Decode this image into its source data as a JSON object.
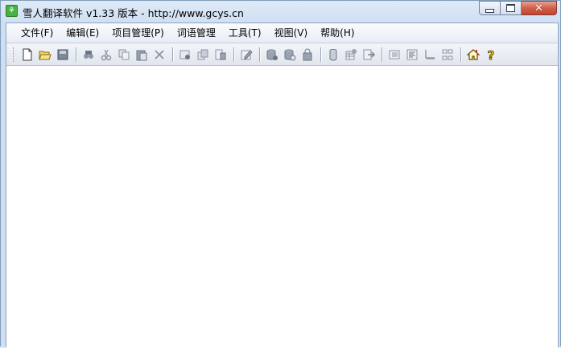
{
  "window": {
    "title": "雪人翻译软件 v1.33 版本 - http://www.gcys.cn"
  },
  "menu": [
    {
      "label": "文件(F)",
      "name": "menu-file"
    },
    {
      "label": "编辑(E)",
      "name": "menu-edit"
    },
    {
      "label": "项目管理(P)",
      "name": "menu-project"
    },
    {
      "label": "词语管理",
      "name": "menu-terms"
    },
    {
      "label": "工具(T)",
      "name": "menu-tools"
    },
    {
      "label": "视图(V)",
      "name": "menu-view"
    },
    {
      "label": "帮助(H)",
      "name": "menu-help"
    }
  ],
  "toolbar_icons": [
    "new-file-icon",
    "open-folder-icon",
    "save-icon",
    "|",
    "find-icon",
    "cut-icon",
    "copy-icon",
    "paste-icon",
    "delete-icon",
    "|",
    "record-icon",
    "copy-record-icon",
    "merge-icon",
    "|",
    "edit-icon",
    "|",
    "db-add-icon",
    "db-settings-icon",
    "db-lock-icon",
    "|",
    "cylinder-icon",
    "grid-settings-icon",
    "export-icon",
    "|",
    "list-view-icon",
    "align-left-icon",
    "ruler-icon",
    "compare-icon",
    "|",
    "home-icon",
    "help-icon"
  ],
  "colors": {
    "accent": "#48b240",
    "close": "#c2452f"
  }
}
